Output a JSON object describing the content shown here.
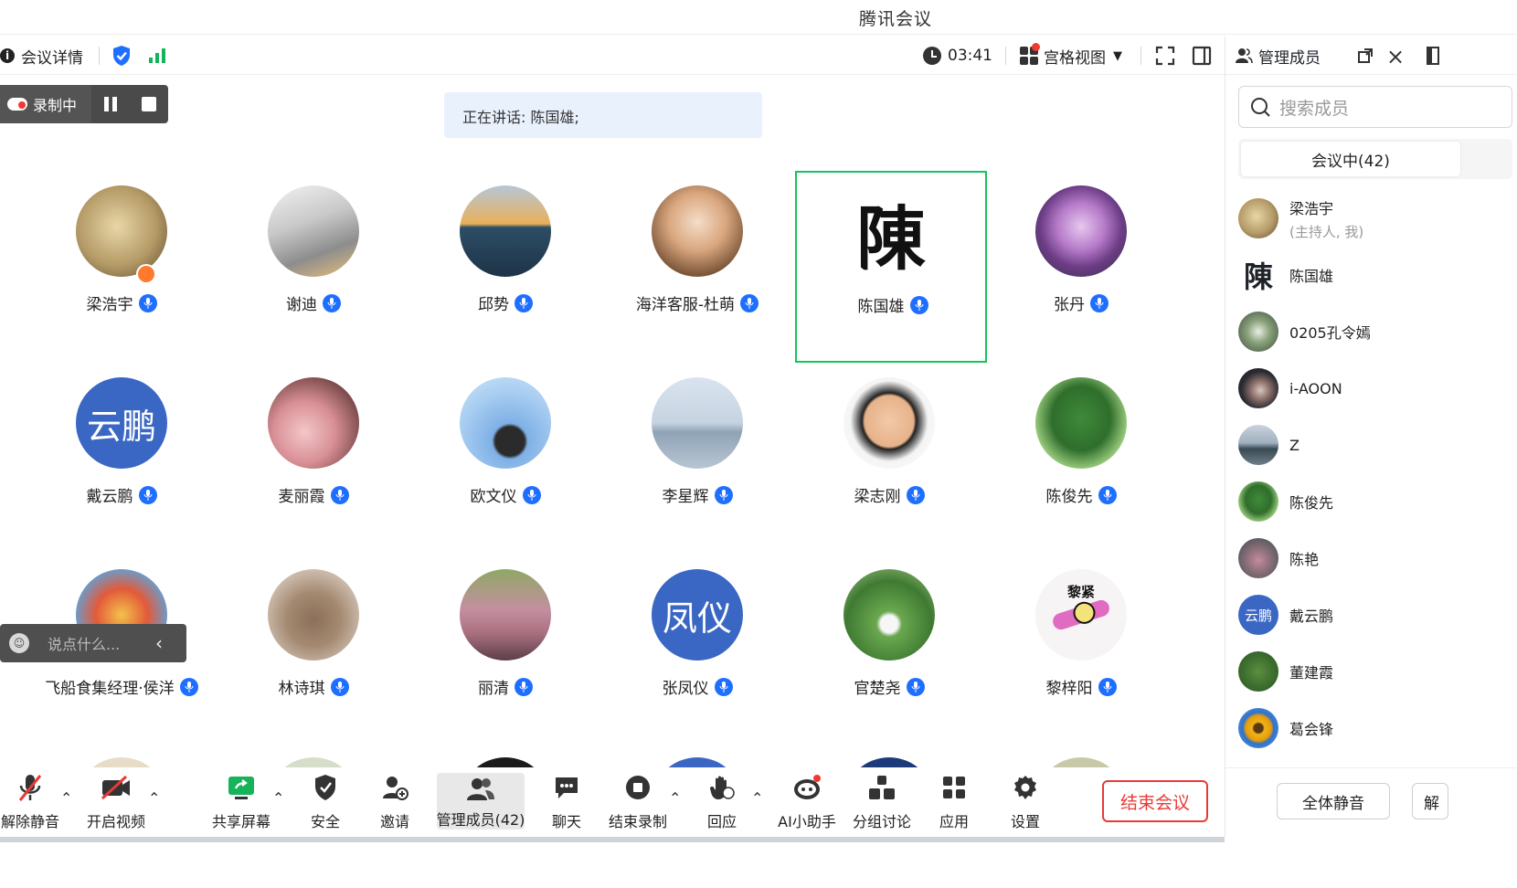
{
  "window": {
    "title": "腾讯会议"
  },
  "topbar": {
    "meeting_details": "会议详情",
    "timer": "03:41",
    "view_mode": "宫格视图"
  },
  "recording": {
    "label": "录制中"
  },
  "speaking": {
    "text": "正在讲话: 陈国雄;"
  },
  "tiles": [
    {
      "name": "梁浩宇"
    },
    {
      "name": "谢迪"
    },
    {
      "name": "邱势"
    },
    {
      "name": "海洋客服-杜萌"
    },
    {
      "name": "陈国雄",
      "avatar_text": "陳"
    },
    {
      "name": "张丹"
    },
    {
      "name": "戴云鹏",
      "avatar_text": "云鹏"
    },
    {
      "name": "麦丽霞"
    },
    {
      "name": "欧文仪"
    },
    {
      "name": "李星辉"
    },
    {
      "name": "梁志刚"
    },
    {
      "name": "陈俊先"
    },
    {
      "name": "飞船食集经理·侯洋"
    },
    {
      "name": "林诗琪"
    },
    {
      "name": "丽清"
    },
    {
      "name": "张凤仪",
      "avatar_text": "凤仪"
    },
    {
      "name": "官楚尧"
    },
    {
      "name": "黎梓阳",
      "avatar_text": "黎紧"
    }
  ],
  "chat": {
    "placeholder": "说点什么..."
  },
  "bottombar": {
    "unmute": "解除静音",
    "start_video": "开启视频",
    "share_screen": "共享屏幕",
    "security": "安全",
    "invite": "邀请",
    "manage_members": "管理成员(42)",
    "chat": "聊天",
    "end_recording": "结束录制",
    "react": "回应",
    "ai_assistant": "AI小助手",
    "breakout": "分组讨论",
    "apps": "应用",
    "settings": "设置",
    "end_meeting": "结束会议"
  },
  "panel": {
    "title": "管理成员",
    "search_placeholder": "搜索成员",
    "tab_in_meeting": "会议中(42)",
    "members": [
      {
        "name": "梁浩宇",
        "sub": "(主持人, 我)"
      },
      {
        "name": "陈国雄",
        "avatar_text": "陳"
      },
      {
        "name": "0205孔令嫣"
      },
      {
        "name": "i-AOON"
      },
      {
        "name": "Z"
      },
      {
        "name": "陈俊先"
      },
      {
        "name": "陈艳"
      },
      {
        "name": "戴云鹏",
        "avatar_text": "云鹏"
      },
      {
        "name": "董建霞"
      },
      {
        "name": "葛会锋"
      }
    ],
    "mute_all": "全体静音",
    "unmute_all_partial": "解"
  },
  "colors": {
    "accent": "#1e6fff",
    "active_border": "#16c35a",
    "end_red": "#e83a36",
    "avatar_blue": "#3b67c4"
  }
}
